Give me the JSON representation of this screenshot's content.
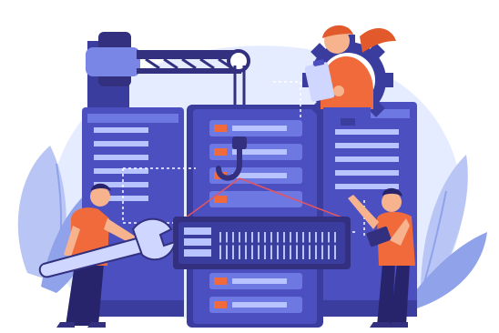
{
  "illustration": {
    "colors": {
      "background": "#ffffff",
      "blob": "#e6ecff",
      "leaf_light": "#b9c6f5",
      "leaf_mid": "#8fa2ea",
      "server_dark": "#3a3c9e",
      "server_mid": "#4b4fc0",
      "server_light": "#6d78e2",
      "server_slot": "#b7c4ff",
      "crane_dark": "#33307f",
      "crane_light": "#7a86e6",
      "accent_orange": "#f06a3c",
      "accent_orange_light": "#f39a72",
      "hair_orange": "#e25a2c",
      "skin": "#f7b28e",
      "pants_navy": "#27246b",
      "tool_light": "#cfd6ff",
      "line_pink": "#e45561"
    },
    "icons": [
      "crane-icon",
      "hook-icon",
      "gear-icon",
      "wrench-icon",
      "server-rack-icon",
      "clipboard-icon",
      "tablet-icon"
    ]
  }
}
